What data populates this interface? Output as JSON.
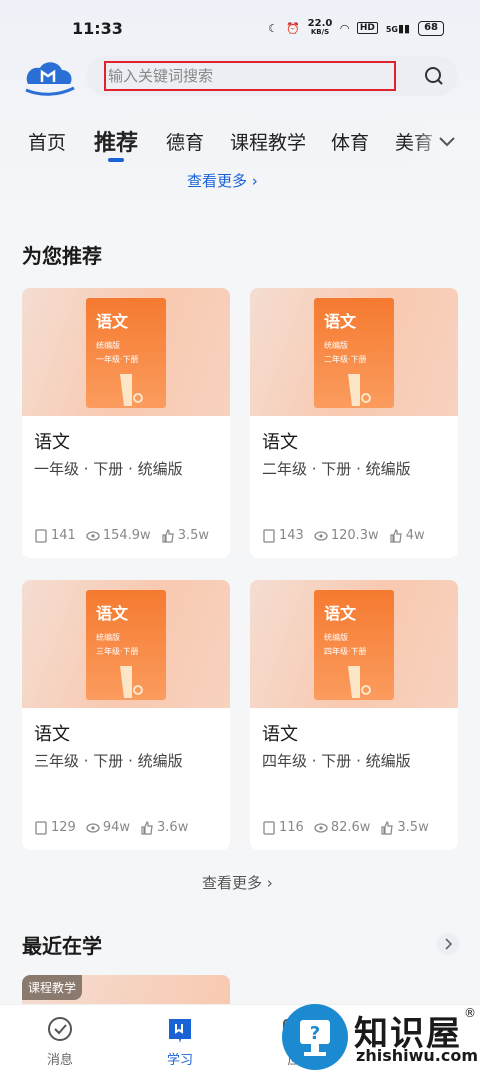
{
  "status": {
    "time": "11:33",
    "speed": "22.0",
    "speed_unit": "KB/S",
    "hd": "HD",
    "net": "5G",
    "battery": "68"
  },
  "search": {
    "placeholder": "输入关键词搜索"
  },
  "tabs": [
    "首页",
    "推荐",
    "德育",
    "课程教学",
    "体育",
    "美育"
  ],
  "more_link_top": "查看更多 ›",
  "recommend": {
    "title": "为您推荐",
    "cards": [
      {
        "book_title": "语文",
        "edition": "统编版",
        "grade_tag": "一年级·下册",
        "title": "语文",
        "subtitle": "一年级 · 下册 · 统编版",
        "lessons": "141",
        "views": "154.9w",
        "likes": "3.5w"
      },
      {
        "book_title": "语文",
        "edition": "统编版",
        "grade_tag": "二年级·下册",
        "title": "语文",
        "subtitle": "二年级 · 下册 · 统编版",
        "lessons": "143",
        "views": "120.3w",
        "likes": "4w"
      },
      {
        "book_title": "语文",
        "edition": "统编版",
        "grade_tag": "三年级·下册",
        "title": "语文",
        "subtitle": "三年级 · 下册 · 统编版",
        "lessons": "129",
        "views": "94w",
        "likes": "3.6w"
      },
      {
        "book_title": "语文",
        "edition": "统编版",
        "grade_tag": "四年级·下册",
        "title": "语文",
        "subtitle": "四年级 · 下册 · 统编版",
        "lessons": "116",
        "views": "82.6w",
        "likes": "3.5w"
      }
    ],
    "more": "查看更多 ›"
  },
  "recent": {
    "title": "最近在学",
    "tag": "课程教学"
  },
  "nav": {
    "messages": "消息",
    "learn": "学习",
    "third": "应"
  },
  "watermark": {
    "name": "知识屋",
    "url": "zhishiwu.com",
    "reg": "®"
  },
  "colors": {
    "accent": "#1a63d6",
    "highlight": "#e0202a",
    "book": "#f57a30"
  }
}
